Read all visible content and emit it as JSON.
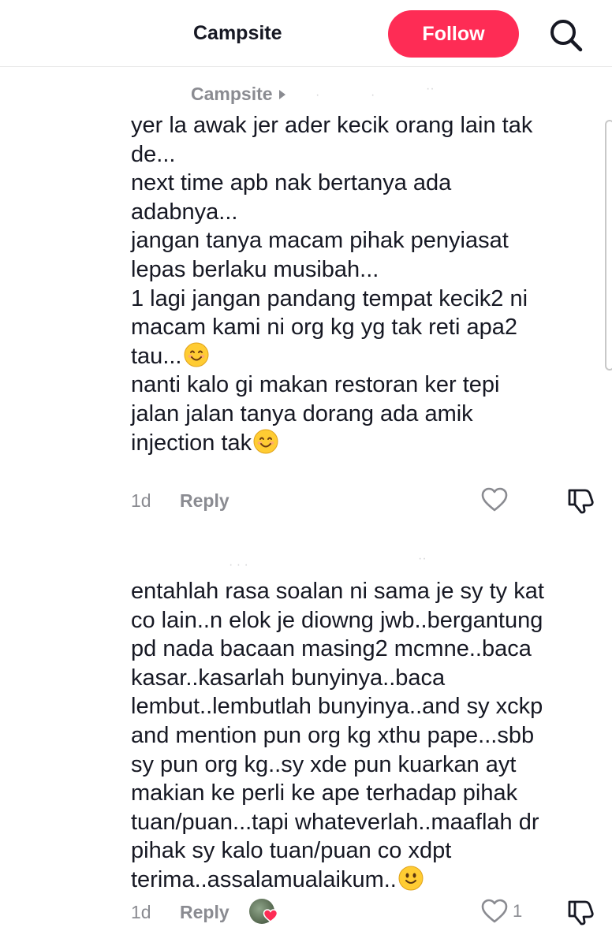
{
  "header": {
    "title": "Campsite",
    "follow_label": "Follow"
  },
  "comment1": {
    "reply_to_author": "Campsite",
    "lines": [
      "yer la awak jer ader kecik orang lain tak",
      "de...",
      "next time apb nak bertanya ada",
      "adabnya...",
      "jangan tanya macam pihak penyiasat",
      "lepas berlaku musibah...",
      "1 lagi jangan pandang tempat kecik2 ni",
      "macam kami ni org kg yg tak reti apa2",
      "tau...",
      "nanti kalo gi makan restoran ker tepi",
      "jalan jalan tanya dorang ada amik",
      "injection tak"
    ],
    "emoji_lines": [
      8,
      11
    ],
    "time": "1d",
    "reply_label": "Reply"
  },
  "comment2": {
    "lines": [
      "entahlah rasa soalan ni sama je sy ty kat",
      "co lain..n elok je diowng jwb..bergantung",
      "pd nada bacaan masing2 mcmne..baca",
      "kasar..kasarlah bunyinya..baca",
      "lembut..lembutlah bunyinya..and sy xckp",
      "and mention pun org kg xthu pape...sbb",
      "sy pun org kg..sy xde pun kuarkan ayt",
      "makian ke perli ke ape terhadap pihak",
      "tuan/puan...tapi whateverlah..maaflah dr",
      "pihak sy kalo tuan/puan co xdpt",
      "terima..assalamualaikum.."
    ],
    "time": "1d",
    "reply_label": "Reply",
    "like_count": "1"
  },
  "colors": {
    "follow_button": "#fe2c55",
    "muted_text": "#8a8b91",
    "body_text": "#161823"
  },
  "icons": [
    "search-icon",
    "heart-outline-icon",
    "dislike-icon",
    "smiling-emoji",
    "slight-smile-emoji",
    "heart-filled-icon",
    "user-avatar"
  ]
}
